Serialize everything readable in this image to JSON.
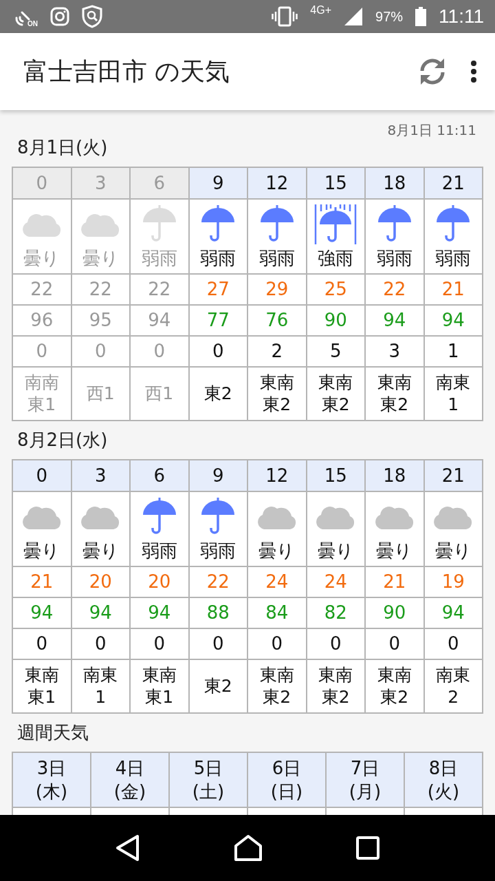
{
  "status_bar": {
    "nfc_label": "ON",
    "network": "4G+",
    "battery": "97%",
    "time": "11:11"
  },
  "app_bar": {
    "title": "富士吉田市 の天気"
  },
  "updated": "8月1日 11:11",
  "days": [
    {
      "date": "8月1日(火)",
      "slots": [
        {
          "hour": "0",
          "past": true,
          "kind": "cloud",
          "weather": "曇り",
          "temp": "22",
          "humidity": "96",
          "precip": "0",
          "wind": "南南東1"
        },
        {
          "hour": "3",
          "past": true,
          "kind": "cloud",
          "weather": "曇り",
          "temp": "22",
          "humidity": "95",
          "precip": "0",
          "wind": "西1"
        },
        {
          "hour": "6",
          "past": true,
          "kind": "rain",
          "weather": "弱雨",
          "temp": "22",
          "humidity": "94",
          "precip": "0",
          "wind": "西1"
        },
        {
          "hour": "9",
          "past": false,
          "kind": "rain",
          "weather": "弱雨",
          "temp": "27",
          "humidity": "77",
          "precip": "0",
          "wind": "東2"
        },
        {
          "hour": "12",
          "past": false,
          "kind": "rain",
          "weather": "弱雨",
          "temp": "29",
          "humidity": "76",
          "precip": "2",
          "wind": "東南東2"
        },
        {
          "hour": "15",
          "past": false,
          "kind": "heavy_rain",
          "weather": "強雨",
          "temp": "25",
          "humidity": "90",
          "precip": "5",
          "wind": "東南東2"
        },
        {
          "hour": "18",
          "past": false,
          "kind": "rain",
          "weather": "弱雨",
          "temp": "22",
          "humidity": "94",
          "precip": "3",
          "wind": "東南東2"
        },
        {
          "hour": "21",
          "past": false,
          "kind": "rain",
          "weather": "弱雨",
          "temp": "21",
          "humidity": "94",
          "precip": "1",
          "wind": "南東1"
        }
      ]
    },
    {
      "date": "8月2日(水)",
      "slots": [
        {
          "hour": "0",
          "past": false,
          "kind": "cloud",
          "weather": "曇り",
          "temp": "21",
          "humidity": "94",
          "precip": "0",
          "wind": "東南東1"
        },
        {
          "hour": "3",
          "past": false,
          "kind": "cloud",
          "weather": "曇り",
          "temp": "20",
          "humidity": "94",
          "precip": "0",
          "wind": "南東1"
        },
        {
          "hour": "6",
          "past": false,
          "kind": "rain",
          "weather": "弱雨",
          "temp": "20",
          "humidity": "94",
          "precip": "0",
          "wind": "東南東1"
        },
        {
          "hour": "9",
          "past": false,
          "kind": "rain",
          "weather": "弱雨",
          "temp": "22",
          "humidity": "88",
          "precip": "0",
          "wind": "東2"
        },
        {
          "hour": "12",
          "past": false,
          "kind": "cloud",
          "weather": "曇り",
          "temp": "24",
          "humidity": "84",
          "precip": "0",
          "wind": "東南東2"
        },
        {
          "hour": "15",
          "past": false,
          "kind": "cloud",
          "weather": "曇り",
          "temp": "24",
          "humidity": "82",
          "precip": "0",
          "wind": "東南東2"
        },
        {
          "hour": "18",
          "past": false,
          "kind": "cloud",
          "weather": "曇り",
          "temp": "21",
          "humidity": "90",
          "precip": "0",
          "wind": "東南東2"
        },
        {
          "hour": "21",
          "past": false,
          "kind": "cloud",
          "weather": "曇り",
          "temp": "19",
          "humidity": "94",
          "precip": "0",
          "wind": "南東2"
        }
      ]
    }
  ],
  "weekly": {
    "title": "週間天気",
    "days": [
      {
        "date": "3日",
        "weekday": "(木)"
      },
      {
        "date": "4日",
        "weekday": "(金)"
      },
      {
        "date": "5日",
        "weekday": "(土)"
      },
      {
        "date": "6日",
        "weekday": "(日)"
      },
      {
        "date": "7日",
        "weekday": "(月)"
      },
      {
        "date": "8日",
        "weekday": "(火)"
      }
    ]
  }
}
